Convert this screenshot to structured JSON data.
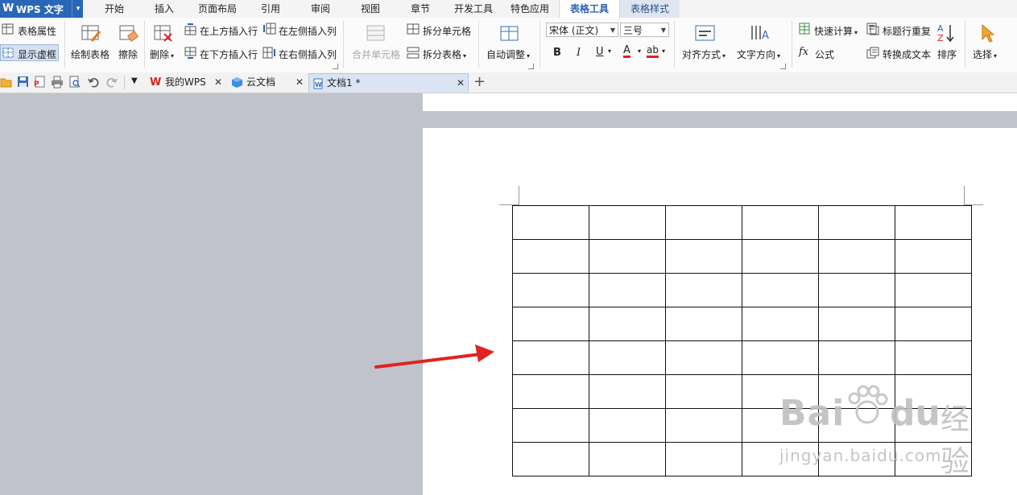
{
  "app": {
    "logo": "W",
    "name": "WPS 文字",
    "dropdown": "▾"
  },
  "menu_tabs": [
    "开始",
    "插入",
    "页面布局",
    "引用",
    "审阅",
    "视图",
    "章节",
    "开发工具",
    "特色应用",
    "表格工具",
    "表格样式"
  ],
  "active_tab": "表格工具",
  "ribbon": {
    "table_props": "表格属性",
    "show_gridlines": "显示虚框",
    "draw_table": "绘制表格",
    "erase": "擦除",
    "delete": "删除",
    "insert_above": "在上方插入行",
    "insert_below": "在下方插入行",
    "insert_left": "在左侧插入列",
    "insert_right": "在右侧插入列",
    "merge_cells": "合并单元格",
    "split_cells": "拆分单元格",
    "split_table": "拆分表格",
    "auto_fit": "自动调整",
    "font_name": "宋体 (正文)",
    "font_size": "三号",
    "bold": "B",
    "italic": "I",
    "underline": "U",
    "font_color": "A",
    "highlight": "ab",
    "align": "对齐方式",
    "text_direction": "文字方向",
    "quick_calc": "快速计算",
    "formula": "公式",
    "formula_icon": "fx",
    "repeat_header": "标题行重复",
    "convert_text": "转换成文本",
    "sort": "排序",
    "select": "选择",
    "colors": {
      "font_color": "#d9251d",
      "highlight": "#d9251d",
      "accent": "#2a66b8"
    }
  },
  "doc_tabs": [
    {
      "label": "我的WPS",
      "icon": "wps-icon"
    },
    {
      "label": "云文档",
      "icon": "cloud-doc-icon"
    },
    {
      "label": "文档1 *",
      "icon": "document-icon"
    }
  ],
  "new_tab": "+",
  "table": {
    "rows": 8,
    "cols": 6
  },
  "watermark": {
    "brand": "Bai",
    "brand2": "du",
    "cn": "经验",
    "url": "jingyan.baidu.com"
  }
}
